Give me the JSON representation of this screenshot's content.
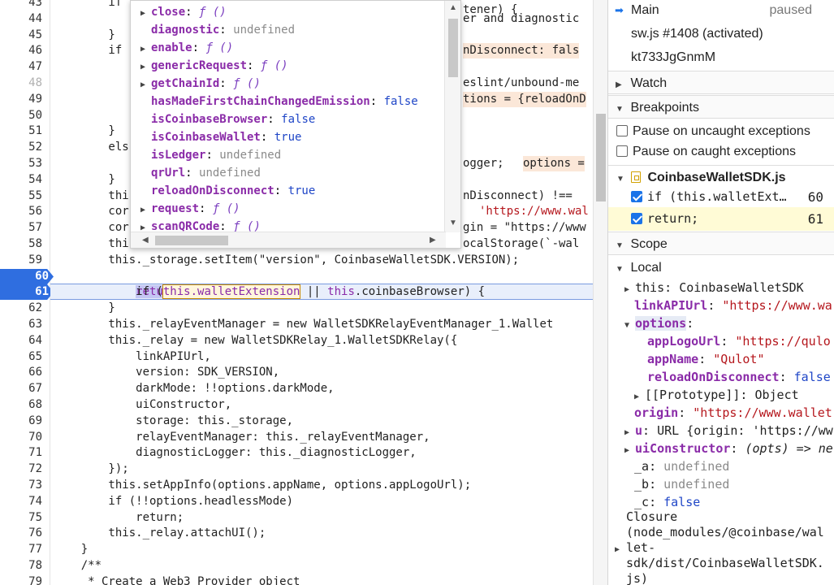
{
  "editor": {
    "lines": [
      {
        "n": "43",
        "text": "        if"
      },
      {
        "n": "44",
        "text": ""
      },
      {
        "n": "45",
        "text": "        }"
      },
      {
        "n": "46",
        "text": "        if"
      },
      {
        "n": "47",
        "text": ""
      },
      {
        "n": "48",
        "text": ""
      },
      {
        "n": "49",
        "text": ""
      },
      {
        "n": "50",
        "text": ""
      },
      {
        "n": "51",
        "text": "        }"
      },
      {
        "n": "52",
        "text": "        els"
      },
      {
        "n": "53",
        "text": ""
      },
      {
        "n": "54",
        "text": "        }"
      },
      {
        "n": "55",
        "text": "        thi"
      },
      {
        "n": "56",
        "text": "        cor"
      },
      {
        "n": "57",
        "text": "        cor"
      },
      {
        "n": "58",
        "text": "        thi"
      },
      {
        "n": "59",
        "text": "        this._storage.setItem(\"version\", CoinbaseWalletSDK.VERSION);"
      },
      {
        "n": "60",
        "text": ""
      },
      {
        "n": "61",
        "text": ""
      },
      {
        "n": "62",
        "text": "        }"
      },
      {
        "n": "63",
        "text": "        this._relayEventManager = new WalletSDKRelayEventManager_1.Wallet"
      },
      {
        "n": "64",
        "text": "        this._relay = new WalletSDKRelay_1.WalletSDKRelay({"
      },
      {
        "n": "65",
        "text": "            linkAPIUrl,"
      },
      {
        "n": "66",
        "text": "            version: SDK_VERSION,"
      },
      {
        "n": "67",
        "text": "            darkMode: !!options.darkMode,"
      },
      {
        "n": "68",
        "text": "            uiConstructor,"
      },
      {
        "n": "69",
        "text": "            storage: this._storage,"
      },
      {
        "n": "70",
        "text": "            relayEventManager: this._relayEventManager,"
      },
      {
        "n": "71",
        "text": "            diagnosticLogger: this._diagnosticLogger,"
      },
      {
        "n": "72",
        "text": "        });"
      },
      {
        "n": "73",
        "text": "        this.setAppInfo(options.appName, options.appLogoUrl);"
      },
      {
        "n": "74",
        "text": "        if (!!options.headlessMode)"
      },
      {
        "n": "75",
        "text": "            return;"
      },
      {
        "n": "76",
        "text": "        this._relay.attachUI();"
      },
      {
        "n": "77",
        "text": "    }"
      },
      {
        "n": "78",
        "text": "    /**"
      },
      {
        "n": "79",
        "text": "     * Create a Web3 Provider object"
      }
    ],
    "right_fragments": [
      {
        "line": "43",
        "text": "tener) {"
      },
      {
        "line": "44",
        "text": "er and diagnostic"
      },
      {
        "line": "46",
        "text": "nDisconnect: fals"
      },
      {
        "line": "48",
        "text": "eslint/unbound-me"
      },
      {
        "line": "49",
        "text": "tions = {reloadOnD"
      },
      {
        "line": "53a",
        "text": "ogger;"
      },
      {
        "line": "53b",
        "text": "options ="
      },
      {
        "line": "55",
        "text": "nDisconnect) !=="
      },
      {
        "line": "56",
        "text": "'https://www.wal"
      },
      {
        "line": "57",
        "text": "gin = \"https://www"
      },
      {
        "line": "58",
        "text": "ocalStorage(`-wal"
      }
    ],
    "line60_parts": [
      "        if (",
      "this.walletExtension",
      " || ",
      "this",
      ".coinbaseBrowser) {"
    ],
    "line61_return": "return"
  },
  "popover": {
    "rows": [
      {
        "expandable": true,
        "key": "close",
        "value": "ƒ ()",
        "kind": "fn"
      },
      {
        "expandable": false,
        "key": "diagnostic",
        "value": "undefined",
        "kind": "undef"
      },
      {
        "expandable": true,
        "key": "enable",
        "value": "ƒ ()",
        "kind": "fn"
      },
      {
        "expandable": true,
        "key": "genericRequest",
        "value": "ƒ ()",
        "kind": "fn"
      },
      {
        "expandable": true,
        "key": "getChainId",
        "value": "ƒ ()",
        "kind": "fn"
      },
      {
        "expandable": false,
        "key": "hasMadeFirstChainChangedEmission",
        "value": "false",
        "kind": "bool"
      },
      {
        "expandable": false,
        "key": "isCoinbaseBrowser",
        "value": "false",
        "kind": "bool"
      },
      {
        "expandable": false,
        "key": "isCoinbaseWallet",
        "value": "true",
        "kind": "bool"
      },
      {
        "expandable": false,
        "key": "isLedger",
        "value": "undefined",
        "kind": "undef"
      },
      {
        "expandable": false,
        "key": "qrUrl",
        "value": "undefined",
        "kind": "undef"
      },
      {
        "expandable": false,
        "key": "reloadOnDisconnect",
        "value": "true",
        "kind": "bool"
      },
      {
        "expandable": true,
        "key": "request",
        "value": "ƒ ()",
        "kind": "fn"
      },
      {
        "expandable": true,
        "key": "scanQRCode",
        "value": "ƒ ()",
        "kind": "fn"
      }
    ]
  },
  "sidebar": {
    "threads": [
      {
        "label": "Main",
        "status": "paused"
      },
      {
        "label": "sw.js #1408 (activated)",
        "status": ""
      },
      {
        "label": "kt733JgGnmM",
        "status": ""
      }
    ],
    "watch_label": "Watch",
    "breakpoints_label": "Breakpoints",
    "pause_uncaught": "Pause on uncaught exceptions",
    "pause_caught": "Pause on caught exceptions",
    "bp_file": "CoinbaseWalletSDK.js",
    "bp_items": [
      {
        "code": "if (this.walletExt…",
        "line": "60"
      },
      {
        "code": "return;",
        "line": "61"
      }
    ],
    "scope_label": "Scope",
    "local_label": "Local",
    "scope_rows": [
      {
        "indent": 0,
        "tri": "▶",
        "key": "this",
        "sep": ": ",
        "value": "CoinbaseWalletSDK",
        "kind": "plain",
        "keystyle": "plain"
      },
      {
        "indent": 1,
        "tri": "",
        "key": "linkAPIUrl",
        "sep": ": ",
        "value": "\"https://www.wa",
        "kind": "str",
        "keystyle": "key"
      },
      {
        "indent": 0,
        "tri": "▼",
        "key": "options",
        "sep": ":",
        "value": "",
        "kind": "plain",
        "keystyle": "key"
      },
      {
        "indent": 2,
        "tri": "",
        "key": "appLogoUrl",
        "sep": ": ",
        "value": "\"https://qulo",
        "kind": "str",
        "keystyle": "key"
      },
      {
        "indent": 2,
        "tri": "",
        "key": "appName",
        "sep": ": ",
        "value": "\"Qulot\"",
        "kind": "str",
        "keystyle": "key"
      },
      {
        "indent": 2,
        "tri": "",
        "key": "reloadOnDisconnect",
        "sep": ": ",
        "value": "false",
        "kind": "bool",
        "keystyle": "key"
      },
      {
        "indent": 1,
        "tri": "▶",
        "key": "[[Prototype]]",
        "sep": ": ",
        "value": "Object",
        "kind": "plain",
        "keystyle": "plain"
      },
      {
        "indent": 1,
        "tri": "",
        "key": "origin",
        "sep": ": ",
        "value": "\"https://www.wallet",
        "kind": "str",
        "keystyle": "key"
      },
      {
        "indent": 0,
        "tri": "▶",
        "key": "u",
        "sep": ": ",
        "value": "URL {origin: 'https://ww",
        "kind": "plain",
        "keystyle": "key"
      },
      {
        "indent": 0,
        "tri": "▶",
        "key": "uiConstructor",
        "sep": ": ",
        "value": "(opts) => ne",
        "kind": "italic",
        "keystyle": "key"
      },
      {
        "indent": 1,
        "tri": "",
        "key": "_a",
        "sep": ": ",
        "value": "undefined",
        "kind": "undef",
        "keystyle": "plain"
      },
      {
        "indent": 1,
        "tri": "",
        "key": "_b",
        "sep": ": ",
        "value": "undefined",
        "kind": "undef",
        "keystyle": "plain"
      },
      {
        "indent": 1,
        "tri": "",
        "key": "_c",
        "sep": ": ",
        "value": "false",
        "kind": "bool",
        "keystyle": "plain"
      }
    ],
    "closure_lines": [
      "Closure",
      "(node_modules/@coinbase/wal",
      "let-",
      "sdk/dist/CoinbaseWalletSDK.",
      "js)"
    ]
  }
}
